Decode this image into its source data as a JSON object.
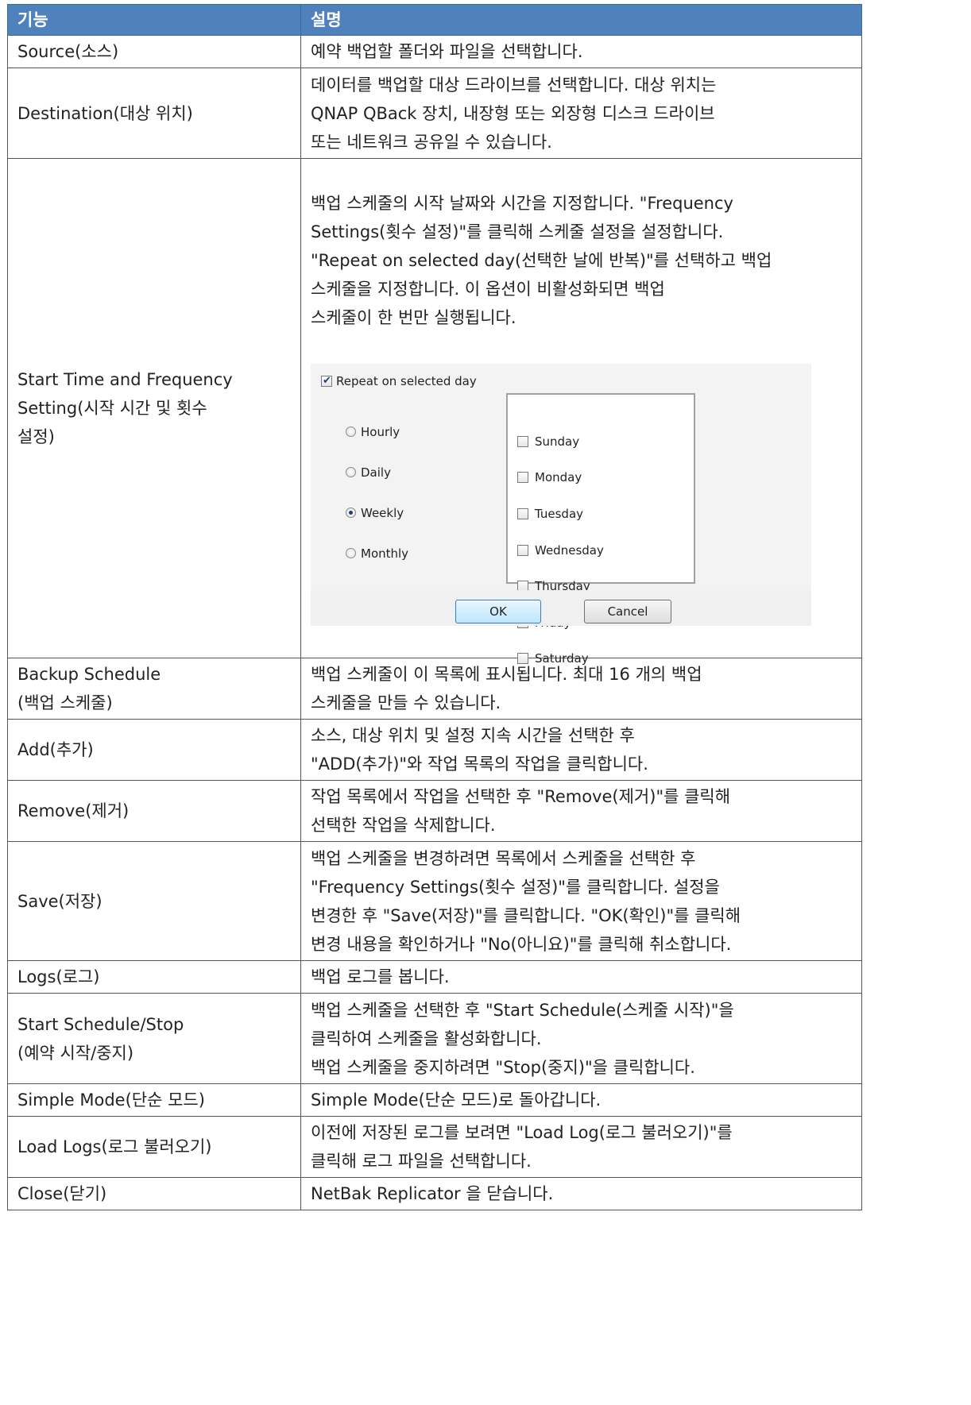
{
  "header": {
    "col_feature": "기능",
    "col_description": "설명"
  },
  "rows": [
    {
      "feature": "Source(소스)",
      "description": "예약 백업할 폴더와 파일을 선택합니다."
    },
    {
      "feature": "Destination(대상 위치)",
      "description": "데이터를 백업할 대상 드라이브를 선택합니다. 대상 위치는\nQNAP QBack 장치, 내장형 또는 외장형 디스크 드라이브\n또는 네트워크 공유일 수 있습니다."
    },
    {
      "feature": "Start Time and Frequency\nSetting(시작 시간 및 횟수\n설정)",
      "description": "백업 스케줄의 시작 날짜와 시간을 지정합니다. \"Frequency\nSettings(횟수 설정)\"를 클릭해 스케줄 설정을 설정합니다.\n\"Repeat on selected day(선택한 날에 반복)\"를 선택하고 백업\n스케줄을 지정합니다. 이 옵션이 비활성화되면 백업\n스케줄이 한 번만 실행됩니다."
    },
    {
      "feature": "Backup Schedule\n(백업 스케줄)",
      "description": "백업 스케줄이 이 목록에 표시됩니다. 최대 16 개의 백업\n스케줄을 만들 수 있습니다."
    },
    {
      "feature": "Add(추가)",
      "description": "소스, 대상 위치 및 설정 지속 시간을 선택한 후\n\"ADD(추가)\"와 작업 목록의 작업을 클릭합니다."
    },
    {
      "feature": "Remove(제거)",
      "description": "작업 목록에서 작업을 선택한 후 \"Remove(제거)\"를 클릭해\n선택한 작업을 삭제합니다."
    },
    {
      "feature": "Save(저장)",
      "description": "백업 스케줄을 변경하려면 목록에서 스케줄을 선택한 후\n\"Frequency Settings(횟수 설정)\"를 클릭합니다. 설정을\n변경한 후 \"Save(저장)\"를 클릭합니다. \"OK(확인)\"를 클릭해\n변경 내용을 확인하거나 \"No(아니요)\"를 클릭해 취소합니다."
    },
    {
      "feature": "Logs(로그)",
      "description": "백업 로그를 봅니다."
    },
    {
      "feature": "Start Schedule/Stop\n(예약 시작/중지)",
      "description": "백업 스케줄을 선택한 후 \"Start Schedule(스케줄 시작)\"을\n클릭하여 스케줄을 활성화합니다.\n백업 스케줄을 중지하려면 \"Stop(중지)\"을 클릭합니다."
    },
    {
      "feature": "Simple Mode(단순 모드)",
      "description": "Simple Mode(단순 모드)로 돌아갑니다."
    },
    {
      "feature": "Load Logs(로그 불러오기)",
      "description": "이전에 저장된 로그를 보려면 \"Load Log(로그 불러오기)\"를\n클릭해 로그 파일을 선택합니다."
    },
    {
      "feature": "Close(닫기)",
      "description": "NetBak Replicator 을 닫습니다."
    }
  ],
  "dialog": {
    "repeat_label": "Repeat on selected day",
    "repeat_checked": true,
    "frequency_options": [
      "Hourly",
      "Daily",
      "Weekly",
      "Monthly"
    ],
    "selected_frequency": "Weekly",
    "days": [
      "Sunday",
      "Monday",
      "Tuesday",
      "Wednesday",
      "Thursday",
      "Friday",
      "Saturday"
    ],
    "ok_label": "OK",
    "cancel_label": "Cancel"
  }
}
